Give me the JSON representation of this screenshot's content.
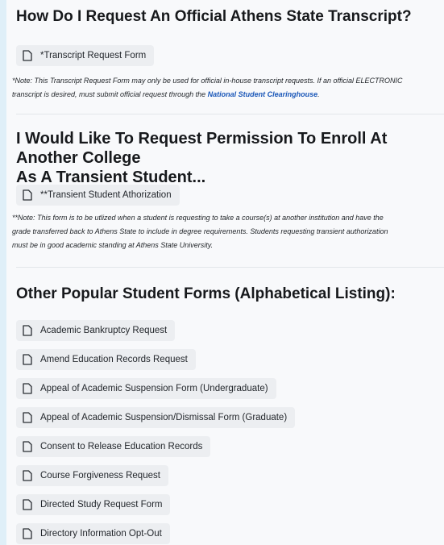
{
  "sections": {
    "transcript": {
      "title": "How Do I Request An Official Athens State Transcript?",
      "form_label": "*Transcript Request Form",
      "note_line1": "*Note: This Transcript Request Form may only be used for official in-house transcript requests. If an official ELECTRONIC",
      "note_line2_prefix": "transcript is desired, must submit official request through the ",
      "note_link": "National Student Clearinghouse",
      "note_line2_suffix": "."
    },
    "transient": {
      "title_line1": "I Would Like To Request Permission To Enroll At Another College",
      "title_line2": "As A Transient Student...",
      "form_label": "**Transient Student Athorization",
      "note_line1": "**Note: This form is to be utlized when a student is requesting to take a course(s) at another institution and have the",
      "note_line2": "grade transferred back to Athens State to include in degree requirements. Students requesting transient authorization",
      "note_line3": "must be in good academic standing at Athens State University."
    },
    "popular": {
      "title": "Other Popular Student Forms (Alphabetical Listing):",
      "forms": [
        "Academic Bankruptcy Request",
        "Amend Education Records Request",
        "Appeal of Academic Suspension Form (Undergraduate)",
        "Appeal of Academic Suspension/Dismissal Form (Graduate)",
        "Consent to Release Education Records",
        "Course Forgiveness Request",
        "Directed Study Request Form",
        "Directory Information Opt-Out",
        ""
      ]
    }
  },
  "icon": "document-icon",
  "colors": {
    "background": "#f8f9fb",
    "outer": "#dfeff8",
    "pill": "#eceef1",
    "link": "#1a57b8"
  }
}
